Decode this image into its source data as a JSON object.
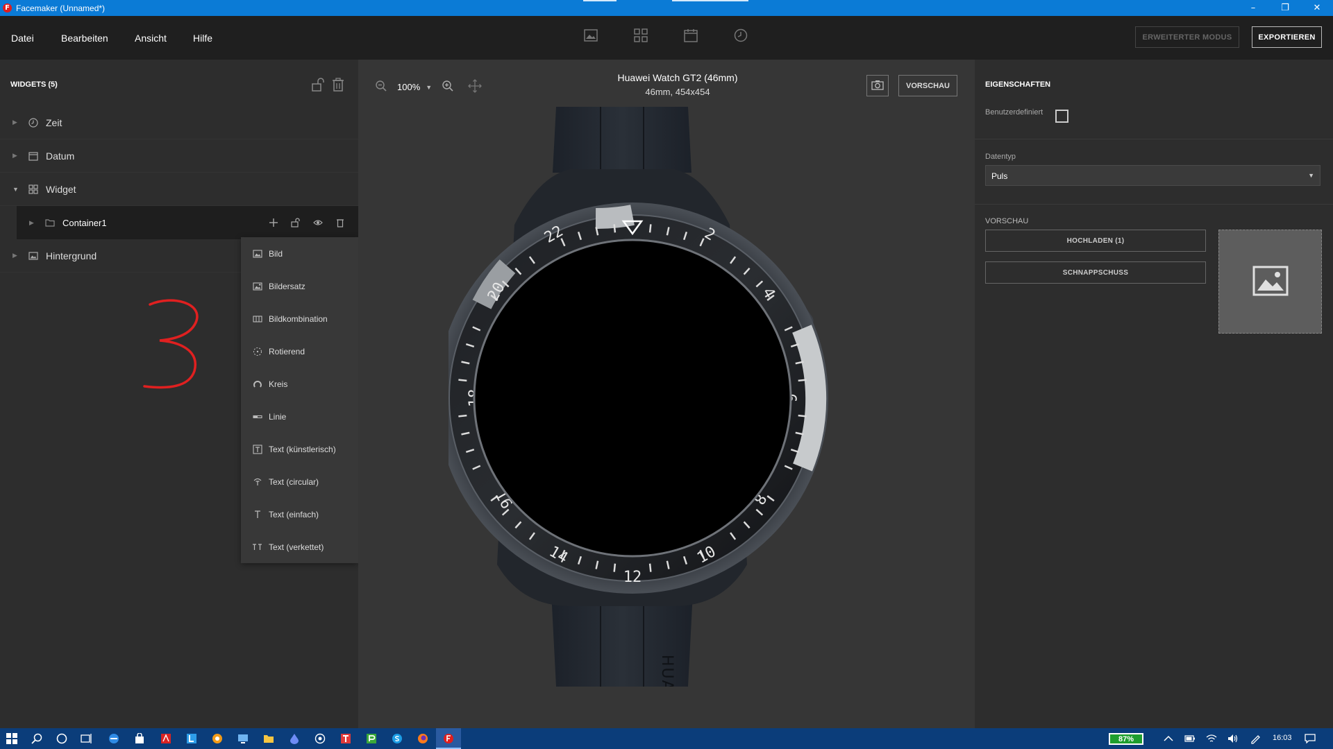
{
  "window": {
    "title": "Facemaker (Unnamed*)",
    "controls": [
      "minimize",
      "restore",
      "close"
    ]
  },
  "menu": {
    "items": [
      "Datei",
      "Bearbeiten",
      "Ansicht",
      "Hilfe"
    ],
    "advanced_mode": "ERWEITERTER MODUS",
    "export": "EXPORTIEREN"
  },
  "widgets_panel": {
    "header": "WIDGETS (5)",
    "tree": [
      {
        "label": "Zeit",
        "icon": "clock-icon",
        "expanded": false
      },
      {
        "label": "Datum",
        "icon": "calendar-icon",
        "expanded": false
      },
      {
        "label": "Widget",
        "icon": "grid-icon",
        "expanded": true
      },
      {
        "label": "Container1",
        "icon": "folder-icon",
        "expanded": false,
        "selected": true
      },
      {
        "label": "Hintergrund",
        "icon": "image-icon",
        "expanded": false
      }
    ],
    "annotation": "3"
  },
  "add_menu": {
    "items": [
      {
        "label": "Bild",
        "icon": "image-icon"
      },
      {
        "label": "Bildersatz",
        "icon": "image-set-icon"
      },
      {
        "label": "Bildkombination",
        "icon": "image-combination-icon"
      },
      {
        "label": "Rotierend",
        "icon": "rotate-icon"
      },
      {
        "label": "Kreis",
        "icon": "circle-icon"
      },
      {
        "label": "Linie",
        "icon": "line-icon"
      },
      {
        "label": "Text (künstlerisch)",
        "icon": "text-box-icon"
      },
      {
        "label": "Text (circular)",
        "icon": "text-circular-icon"
      },
      {
        "label": "Text (einfach)",
        "icon": "text-icon"
      },
      {
        "label": "Text (verkettet)",
        "icon": "text-chained-icon"
      }
    ]
  },
  "canvas": {
    "zoom": "100%",
    "device_name": "Huawei Watch GT2 (46mm)",
    "device_spec": "46mm, 454x454",
    "preview_button": "VORSCHAU",
    "bezel_numbers": [
      "2",
      "4",
      "6",
      "8",
      "10",
      "12",
      "14",
      "16",
      "18",
      "20",
      "22"
    ],
    "strap_text": "HUAWEI"
  },
  "properties": {
    "header": "EIGENSCHAFTEN",
    "custom_label": "Benutzerdefiniert",
    "custom_checked": false,
    "datatype_label": "Datentyp",
    "datatype_value": "Puls",
    "preview_section": "VORSCHAU",
    "upload_button": "HOCHLADEN (1)",
    "snapshot_button": "SCHNAPPSCHUSS"
  },
  "taskbar": {
    "battery": "87%",
    "time": "16:03"
  },
  "colors": {
    "titlebar": "#0b7bd6",
    "taskbar": "#0b3d7a",
    "battery": "#1e9e2e",
    "annotation": "#e02020"
  }
}
